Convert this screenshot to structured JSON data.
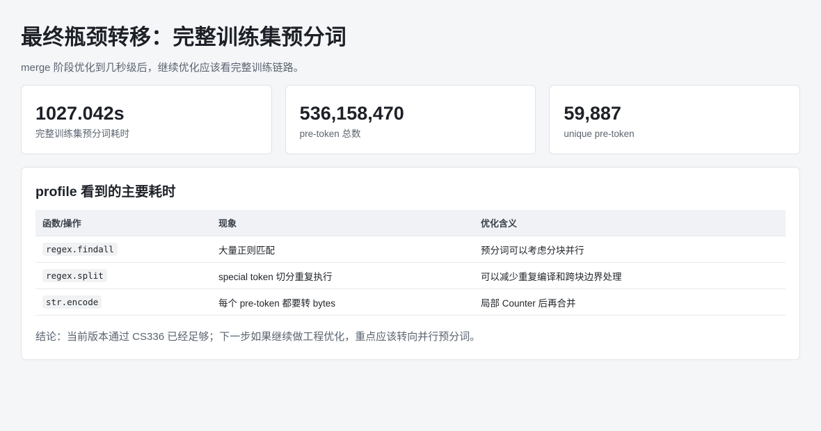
{
  "header": {
    "title": "最终瓶颈转移：完整训练集预分词",
    "subtitle": "merge 阶段优化到几秒级后，继续优化应该看完整训练链路。"
  },
  "stats": [
    {
      "value": "1027.042s",
      "label": "完整训练集预分词耗时"
    },
    {
      "value": "536,158,470",
      "label": "pre-token 总数"
    },
    {
      "value": "59,887",
      "label": "unique pre-token"
    }
  ],
  "panel": {
    "title": "profile 看到的主要耗时",
    "columns": [
      "函数/操作",
      "现象",
      "优化含义"
    ],
    "rows": [
      {
        "func": "regex.findall",
        "symptom": "大量正则匹配",
        "meaning": "预分词可以考虑分块并行"
      },
      {
        "func": "regex.split",
        "symptom": "special token 切分重复执行",
        "meaning": "可以减少重复编译和跨块边界处理"
      },
      {
        "func": "str.encode",
        "symptom": "每个 pre-token 都要转 bytes",
        "meaning": "局部 Counter 后再合并"
      }
    ],
    "conclusion": "结论：当前版本通过 CS336 已经足够；下一步如果继续做工程优化，重点应该转向并行预分词。"
  }
}
